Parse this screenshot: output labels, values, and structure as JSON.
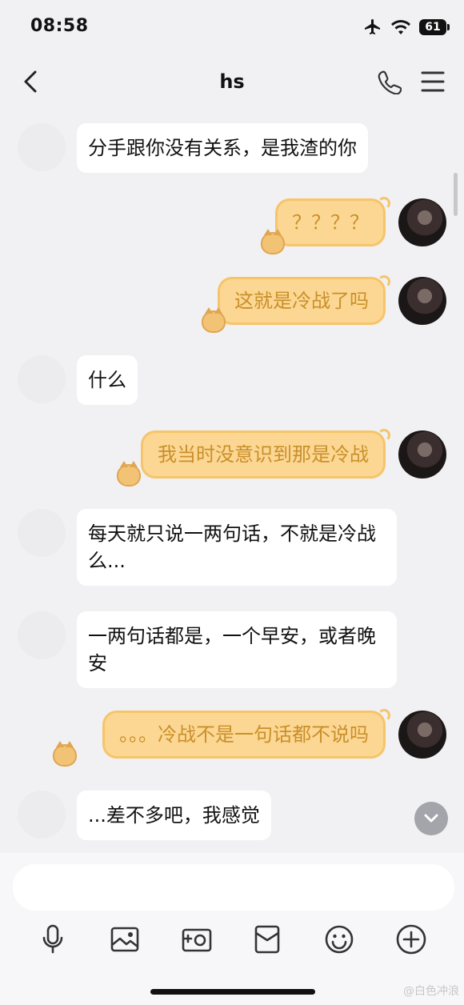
{
  "status_bar": {
    "time": "08:58",
    "battery": "61"
  },
  "header": {
    "title": "hs"
  },
  "messages": [
    {
      "side": "left",
      "text": "分手跟你没有关系，是我渣的你"
    },
    {
      "side": "right",
      "text": "？？？？"
    },
    {
      "side": "right",
      "text": "这就是冷战了吗"
    },
    {
      "side": "left",
      "text": "什么"
    },
    {
      "side": "right",
      "text": "我当时没意识到那是冷战"
    },
    {
      "side": "left",
      "text": "每天就只说一两句话，不就是冷战么..."
    },
    {
      "side": "left",
      "text": "一两句话都是，一个早安，或者晚安"
    },
    {
      "side": "right",
      "text": "。。。冷战不是一句话都不说吗"
    },
    {
      "side": "left",
      "text": "...差不多吧，我感觉"
    }
  ],
  "input": {
    "placeholder": ""
  },
  "toolbar": [
    "microphone-icon",
    "image-icon",
    "camera-icon",
    "red-packet-icon",
    "emoji-icon",
    "plus-icon"
  ],
  "watermark": "@白色冲浪"
}
